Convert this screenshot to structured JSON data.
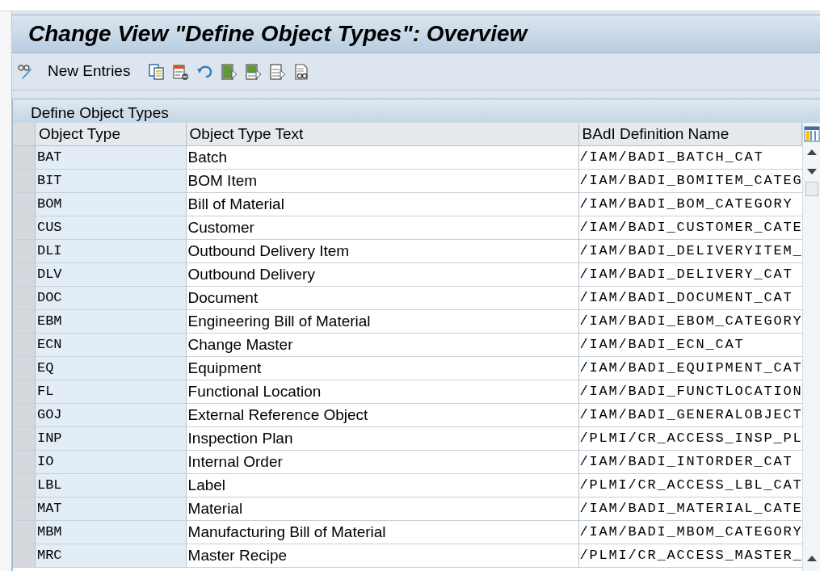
{
  "window": {
    "title": "Change View \"Define Object Types\": Overview"
  },
  "toolbar": {
    "items": [
      {
        "kind": "glasses-pencil"
      },
      {
        "kind": "label",
        "label": "New Entries"
      },
      {
        "kind": "copy"
      },
      {
        "kind": "delete"
      },
      {
        "kind": "undo"
      },
      {
        "kind": "select-all"
      },
      {
        "kind": "select-block"
      },
      {
        "kind": "deselect"
      },
      {
        "kind": "find"
      }
    ]
  },
  "table": {
    "title": "Define Object Types",
    "columns": [
      "Object Type",
      "Object Type Text",
      "BAdI Definition Name"
    ],
    "rows": [
      {
        "type": "BAT",
        "text": "Batch",
        "badi": "/IAM/BADI_BATCH_CAT"
      },
      {
        "type": "BIT",
        "text": "BOM Item",
        "badi": "/IAM/BADI_BOMITEM_CATEG"
      },
      {
        "type": "BOM",
        "text": "Bill of Material",
        "badi": "/IAM/BADI_BOM_CATEGORY"
      },
      {
        "type": "CUS",
        "text": "Customer",
        "badi": "/IAM/BADI_CUSTOMER_CATE"
      },
      {
        "type": "DLI",
        "text": "Outbound Delivery Item",
        "badi": "/IAM/BADI_DELIVERYITEM_"
      },
      {
        "type": "DLV",
        "text": "Outbound Delivery",
        "badi": "/IAM/BADI_DELIVERY_CAT"
      },
      {
        "type": "DOC",
        "text": "Document",
        "badi": "/IAM/BADI_DOCUMENT_CAT"
      },
      {
        "type": "EBM",
        "text": "Engineering Bill of Material",
        "badi": "/IAM/BADI_EBOM_CATEGORY"
      },
      {
        "type": "ECN",
        "text": "Change Master",
        "badi": "/IAM/BADI_ECN_CAT"
      },
      {
        "type": "EQ",
        "text": "Equipment",
        "badi": "/IAM/BADI_EQUIPMENT_CAT"
      },
      {
        "type": "FL",
        "text": "Functional Location",
        "badi": "/IAM/BADI_FUNCTLOCATION"
      },
      {
        "type": "GOJ",
        "text": "External Reference Object",
        "badi": "/IAM/BADI_GENERALOBJECT"
      },
      {
        "type": "INP",
        "text": "Inspection Plan",
        "badi": "/PLMI/CR_ACCESS_INSP_PL"
      },
      {
        "type": "IO",
        "text": "Internal Order",
        "badi": "/IAM/BADI_INTORDER_CAT"
      },
      {
        "type": "LBL",
        "text": "Label",
        "badi": "/PLMI/CR_ACCESS_LBL_CAT"
      },
      {
        "type": "MAT",
        "text": "Material",
        "badi": "/IAM/BADI_MATERIAL_CATE"
      },
      {
        "type": "MBM",
        "text": "Manufacturing Bill of Material",
        "badi": "/IAM/BADI_MBOM_CATEGORY"
      },
      {
        "type": "MRC",
        "text": "Master Recipe",
        "badi": "/PLMI/CR_ACCESS_MASTER_"
      }
    ]
  }
}
